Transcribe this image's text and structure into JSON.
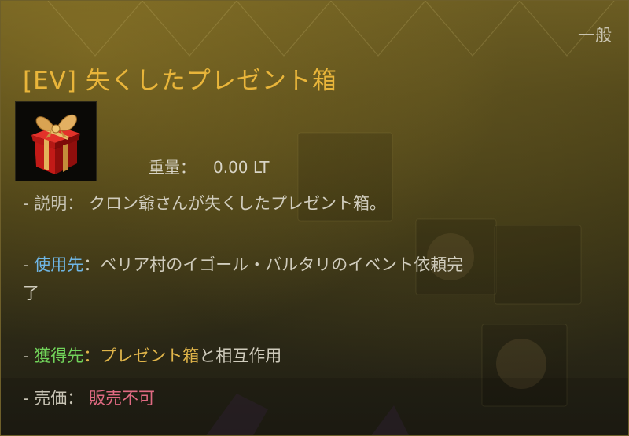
{
  "tooltip": {
    "grade": "一般",
    "title": "[EV] 失くしたプレゼント箱",
    "icon": "gift-box-icon",
    "weight": {
      "label": "重量：",
      "value": "0.00 LT"
    },
    "description": {
      "prefix": "- 説明：",
      "text": "クロン爺さんが失くしたプレゼント箱。"
    },
    "usage": {
      "prefix": "- ",
      "label": "使用先",
      "separator": "：",
      "text_line1": "ベリア村のイゴール・バルタリのイベント依頼完",
      "text_line2": "了"
    },
    "obtain": {
      "prefix": "- ",
      "label": "獲得先",
      "separator": "：",
      "highlight": "プレゼント箱",
      "suffix": "と相互作用"
    },
    "price": {
      "prefix": "- 売価：",
      "value": "販売不可"
    }
  },
  "colors": {
    "title": "#e9b53a",
    "usage_label": "#6fb6e4",
    "obtain_label": "#71d35a",
    "obtain_highlight": "#e0b54a",
    "price_value": "#e06a82",
    "body_text": "#d0ccbd"
  }
}
